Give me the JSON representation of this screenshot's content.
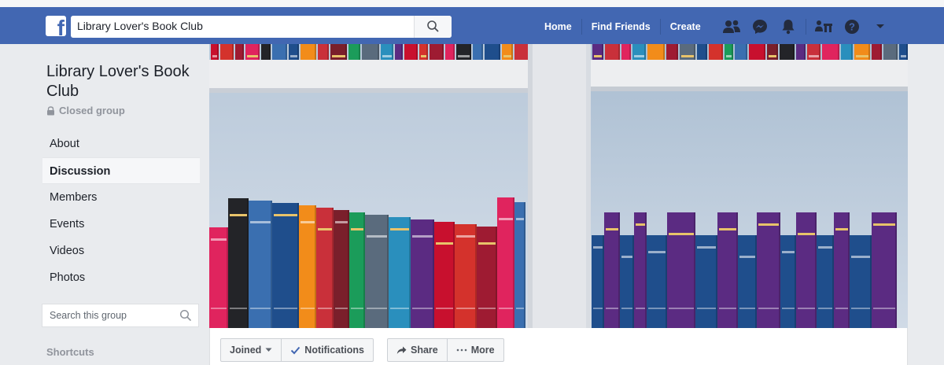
{
  "header": {
    "search_value": "Library Lover's Book Club",
    "nav": [
      "Home",
      "Find Friends",
      "Create"
    ],
    "icons": [
      "friends-icon",
      "messenger-icon",
      "notifications-icon",
      "quick-help-icon",
      "help-icon",
      "account-menu-icon"
    ],
    "brand_color": "#4267b2"
  },
  "group": {
    "title": "Library Lover's Book Club",
    "privacy": "Closed group"
  },
  "sidebar": {
    "items": [
      {
        "label": "About"
      },
      {
        "label": "Discussion"
      },
      {
        "label": "Members"
      },
      {
        "label": "Events"
      },
      {
        "label": "Videos"
      },
      {
        "label": "Photos"
      }
    ],
    "active_item": "Discussion",
    "search_placeholder": "Search this group",
    "shortcuts_label": "Shortcuts"
  },
  "actions": {
    "joined": "Joined",
    "notifications": "Notifications",
    "share": "Share",
    "more": "More"
  }
}
